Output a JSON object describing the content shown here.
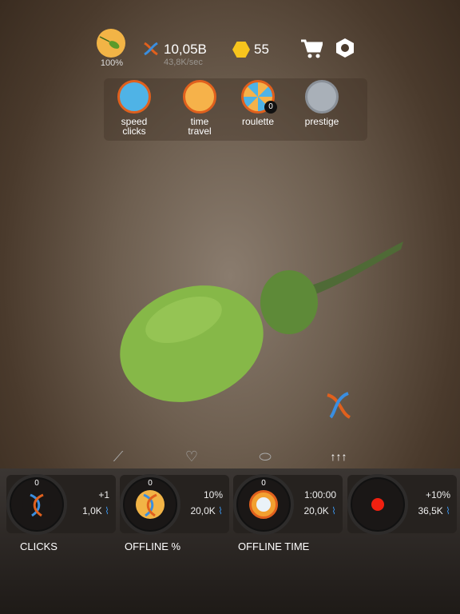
{
  "hud": {
    "progress": "100%",
    "dna_total": "10,05B",
    "dna_rate": "43,8K/sec",
    "coins": "55",
    "icons": [
      "sperm-avatar-icon",
      "dna-icon",
      "coin-icon",
      "cart-icon",
      "settings-hex-icon"
    ]
  },
  "features": [
    {
      "label1": "speed",
      "label2": "clicks",
      "icon": "speed-clicks-icon"
    },
    {
      "label1": "time",
      "label2": "travel",
      "icon": "alarm-clock-icon"
    },
    {
      "label1": "roulette",
      "label2": "",
      "icon": "roulette-wheel-icon",
      "badge": "0"
    },
    {
      "label1": "prestige",
      "label2": "",
      "icon": "prestige-dna-icon"
    }
  ],
  "tabs": [
    {
      "icon": "bone-icon"
    },
    {
      "icon": "heart-icon"
    },
    {
      "icon": "muscle-icon"
    },
    {
      "icon": "upgrades-arrows-icon",
      "glyph": "↑↑↑",
      "active": true
    }
  ],
  "upgrades": [
    {
      "level": "0",
      "value": "+1",
      "cost": "1,0K",
      "label": "CLICKS",
      "color": "#1a1716"
    },
    {
      "level": "0",
      "value": "10%",
      "cost": "20,0K",
      "label": "OFFLINE %",
      "color": "#f2b446"
    },
    {
      "level": "0",
      "value": "1:00:00",
      "cost": "20,0K",
      "label": "OFFLINE TIME",
      "color": "#f2a030"
    },
    {
      "level": "",
      "value": "+10%",
      "cost": "36,5K",
      "label": "",
      "color": "#1a1716"
    }
  ],
  "colors": {
    "accent": "#f2b446",
    "cell": "#8cc04a",
    "dna_blue": "#3a8ee0",
    "dna_orange": "#e0601d"
  }
}
